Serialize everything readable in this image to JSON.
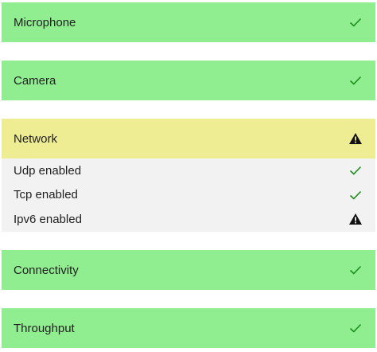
{
  "colors": {
    "ok_background": "#90ee90",
    "warn_background": "#efed94",
    "details_background": "#f2f2f2",
    "check_color": "#1a8f1a",
    "warning_color": "#111111"
  },
  "checks": [
    {
      "label": "Microphone",
      "status": "ok",
      "icon": "check-icon"
    },
    {
      "label": "Camera",
      "status": "ok",
      "icon": "check-icon"
    },
    {
      "label": "Network",
      "status": "warning",
      "icon": "warning-icon",
      "expanded": true,
      "details": [
        {
          "label": "Udp enabled",
          "status": "ok",
          "icon": "check-icon"
        },
        {
          "label": "Tcp enabled",
          "status": "ok",
          "icon": "check-icon"
        },
        {
          "label": "Ipv6 enabled",
          "status": "warning",
          "icon": "warning-icon"
        }
      ]
    },
    {
      "label": "Connectivity",
      "status": "ok",
      "icon": "check-icon"
    },
    {
      "label": "Throughput",
      "status": "ok",
      "icon": "check-icon"
    }
  ]
}
